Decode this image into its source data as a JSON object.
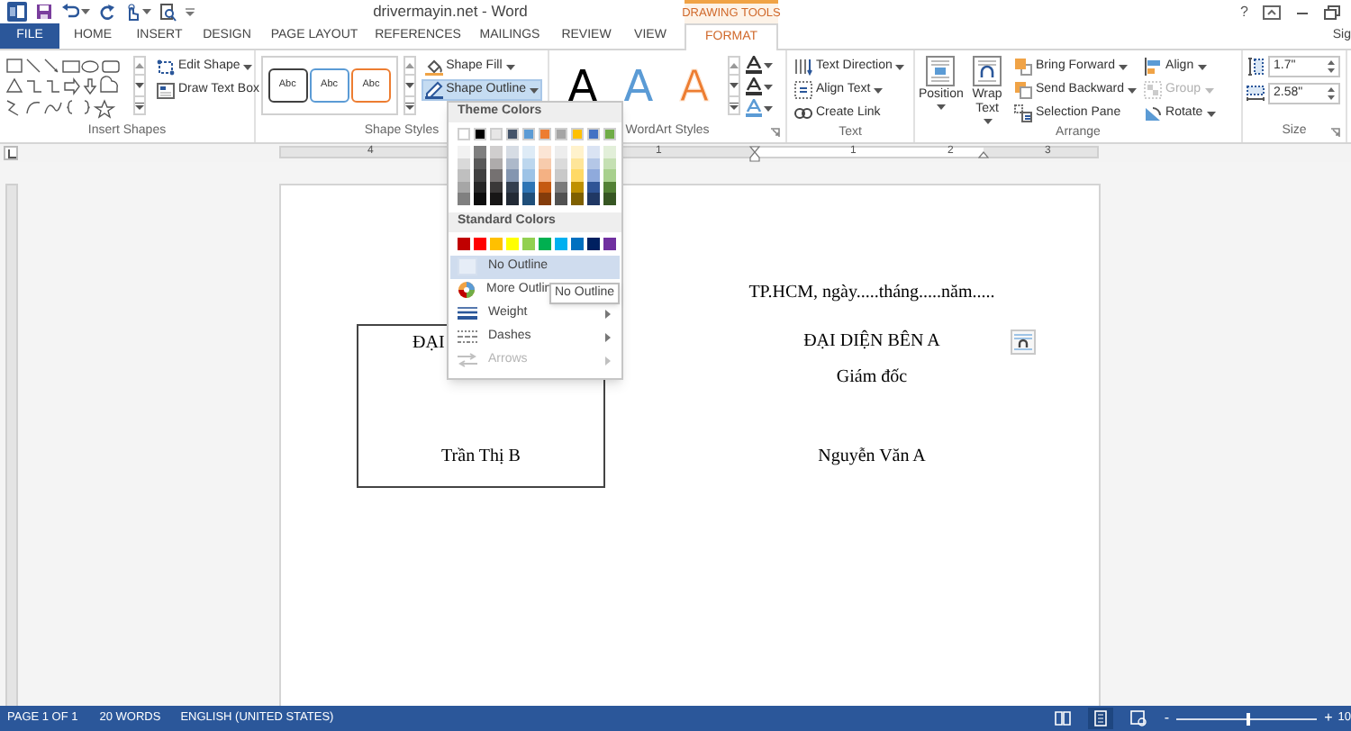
{
  "title_bar": {
    "title": "drivermayin.net - Word",
    "context_label": "DRAWING TOOLS",
    "help": "?"
  },
  "tabs": [
    {
      "label": "FILE",
      "kind": "file",
      "selected": false
    },
    {
      "label": "HOME",
      "kind": "tab",
      "selected": false
    },
    {
      "label": "INSERT",
      "kind": "tab",
      "selected": false
    },
    {
      "label": "DESIGN",
      "kind": "tab",
      "selected": false
    },
    {
      "label": "PAGE LAYOUT",
      "kind": "tab",
      "selected": false
    },
    {
      "label": "REFERENCES",
      "kind": "tab",
      "selected": false
    },
    {
      "label": "MAILINGS",
      "kind": "tab",
      "selected": false
    },
    {
      "label": "REVIEW",
      "kind": "tab",
      "selected": false
    },
    {
      "label": "VIEW",
      "kind": "tab",
      "selected": false
    },
    {
      "label": "FORMAT",
      "kind": "context",
      "selected": true
    }
  ],
  "account": "Sig",
  "ribbon": {
    "insert_shapes": {
      "label": "Insert Shapes",
      "buttons": [
        {
          "label": "Edit Shape",
          "menu": true
        },
        {
          "label": "Draw Text Box",
          "menu": false
        }
      ]
    },
    "shape_styles": {
      "label": "Shape Styles",
      "presets": [
        {
          "label": "Abc",
          "color": "#404040"
        },
        {
          "label": "Abc",
          "color": "#5b9bd5"
        },
        {
          "label": "Abc",
          "color": "#ed7d31"
        }
      ],
      "buttons": [
        {
          "label": "Shape Fill",
          "menu": true,
          "selected": false
        },
        {
          "label": "Shape Outline",
          "menu": true,
          "selected": true
        }
      ]
    },
    "wordart_styles": {
      "label": "WordArt Styles",
      "presets": [
        {
          "label": "A",
          "color": "#000000",
          "outline": false
        },
        {
          "label": "A",
          "color": "#5b9bd5",
          "outline": false
        },
        {
          "label": "A",
          "color": "#ed7d31",
          "outline": true
        }
      ]
    },
    "text": {
      "label": "Text",
      "buttons": [
        {
          "label": "Text Direction",
          "menu": true
        },
        {
          "label": "Align Text",
          "menu": true
        },
        {
          "label": "Create Link",
          "menu": false
        }
      ]
    },
    "arrange": {
      "label": "Arrange",
      "large_buttons": [
        {
          "label": "Position",
          "menu": true
        },
        {
          "label": "Wrap Text",
          "menu": true
        }
      ],
      "buttons": [
        {
          "label": "Bring Forward",
          "menu": true,
          "disabled": false
        },
        {
          "label": "Send Backward",
          "menu": true,
          "disabled": false
        },
        {
          "label": "Selection Pane",
          "menu": false,
          "disabled": false
        },
        {
          "label": "Align",
          "menu": true,
          "disabled": false
        },
        {
          "label": "Group",
          "menu": true,
          "disabled": true
        },
        {
          "label": "Rotate",
          "menu": true,
          "disabled": false
        }
      ]
    },
    "size": {
      "label": "Size",
      "height": "1.7\"",
      "width": "2.58\""
    }
  },
  "ruler": {
    "labels": [
      "4",
      "1",
      "1",
      "2",
      "3"
    ]
  },
  "outline_menu": {
    "theme_header": "Theme Colors",
    "theme_colors": [
      {
        "color": "#ffffff",
        "shades": [
          {
            "color": "#f2f2f2"
          },
          {
            "color": "#d9d9d9"
          },
          {
            "color": "#bfbfbf"
          },
          {
            "color": "#a6a6a6"
          },
          {
            "color": "#808080"
          }
        ]
      },
      {
        "color": "#000000",
        "shades": [
          {
            "color": "#7f7f7f"
          },
          {
            "color": "#595959"
          },
          {
            "color": "#404040"
          },
          {
            "color": "#262626"
          },
          {
            "color": "#0d0d0d"
          }
        ]
      },
      {
        "color": "#e7e6e6",
        "shades": [
          {
            "color": "#d0cece"
          },
          {
            "color": "#aeabab"
          },
          {
            "color": "#757171"
          },
          {
            "color": "#3a3838"
          },
          {
            "color": "#171616"
          }
        ]
      },
      {
        "color": "#44546a",
        "shades": [
          {
            "color": "#d6dce4"
          },
          {
            "color": "#adb9ca"
          },
          {
            "color": "#8496b0"
          },
          {
            "color": "#333f4f"
          },
          {
            "color": "#222a35"
          }
        ]
      },
      {
        "color": "#5b9bd5",
        "shades": [
          {
            "color": "#deebf6"
          },
          {
            "color": "#bdd7ee"
          },
          {
            "color": "#9dc3e6"
          },
          {
            "color": "#2e75b5"
          },
          {
            "color": "#1f4e79"
          }
        ]
      },
      {
        "color": "#ed7d31",
        "shades": [
          {
            "color": "#fbe5d5"
          },
          {
            "color": "#f7cbac"
          },
          {
            "color": "#f4b183"
          },
          {
            "color": "#c55a11"
          },
          {
            "color": "#843c0b"
          }
        ]
      },
      {
        "color": "#a5a5a5",
        "shades": [
          {
            "color": "#ededed"
          },
          {
            "color": "#dbdbdb"
          },
          {
            "color": "#c9c9c9"
          },
          {
            "color": "#7b7b7b"
          },
          {
            "color": "#525252"
          }
        ]
      },
      {
        "color": "#ffc000",
        "shades": [
          {
            "color": "#fff2cc"
          },
          {
            "color": "#fee599"
          },
          {
            "color": "#ffd965"
          },
          {
            "color": "#bf9000"
          },
          {
            "color": "#7f6000"
          }
        ]
      },
      {
        "color": "#4472c4",
        "shades": [
          {
            "color": "#dae3f3"
          },
          {
            "color": "#b4c7e7"
          },
          {
            "color": "#8faadc"
          },
          {
            "color": "#2f5496"
          },
          {
            "color": "#203864"
          }
        ]
      },
      {
        "color": "#70ad47",
        "shades": [
          {
            "color": "#e2efd9"
          },
          {
            "color": "#c5e0b3"
          },
          {
            "color": "#a8d08d"
          },
          {
            "color": "#538135"
          },
          {
            "color": "#375623"
          }
        ]
      }
    ],
    "standard_header": "Standard Colors",
    "standard_colors": [
      {
        "color": "#c00000"
      },
      {
        "color": "#ff0000"
      },
      {
        "color": "#ffc000"
      },
      {
        "color": "#ffff00"
      },
      {
        "color": "#92d050"
      },
      {
        "color": "#00b050"
      },
      {
        "color": "#00b0f0"
      },
      {
        "color": "#0070c0"
      },
      {
        "color": "#002060"
      },
      {
        "color": "#7030a0"
      }
    ],
    "items": [
      {
        "label": "No Outline",
        "kind": "none",
        "selected": true,
        "submenu": false,
        "disabled": false
      },
      {
        "label": "More Outlin",
        "kind": "more",
        "selected": false,
        "submenu": false,
        "disabled": false
      },
      {
        "label": "Weight",
        "kind": "weight",
        "selected": false,
        "submenu": true,
        "disabled": false
      },
      {
        "label": "Dashes",
        "kind": "dashes",
        "selected": false,
        "submenu": true,
        "disabled": false
      },
      {
        "label": "Arrows",
        "kind": "arrows",
        "selected": false,
        "submenu": true,
        "disabled": true
      }
    ]
  },
  "tooltip": "No Outline",
  "document": {
    "date_line": "TP.HCM, ngày.....tháng.....năm.....",
    "left_box": [
      "ĐẠI",
      "Trần Thị B"
    ],
    "right_block": [
      "ĐẠI DIỆN BÊN A",
      "Giám đốc",
      "Nguyễn Văn A"
    ]
  },
  "status_bar": {
    "page": "PAGE 1 OF 1",
    "words": "20 WORDS",
    "language": "ENGLISH (UNITED STATES)",
    "views": [
      {
        "selected": false
      },
      {
        "selected": true
      },
      {
        "selected": false
      }
    ],
    "zoom_out": "-",
    "zoom_in": "+",
    "zoom": "10",
    "level": 0.5
  }
}
